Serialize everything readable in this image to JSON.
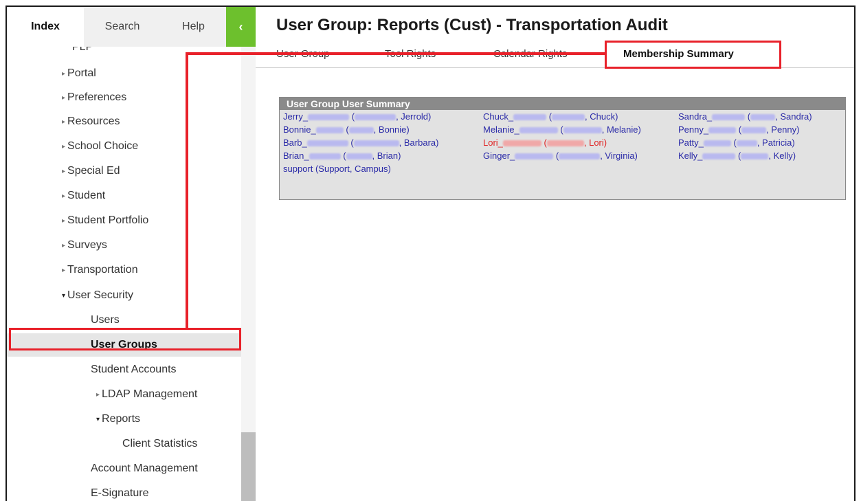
{
  "nav_tabs": [
    "Index",
    "Search",
    "Help"
  ],
  "collapse_glyph": "‹",
  "tree_partial": "PLP",
  "tree": [
    {
      "label": "Portal",
      "arrow": "▸"
    },
    {
      "label": "Preferences",
      "arrow": "▸"
    },
    {
      "label": "Resources",
      "arrow": "▸"
    },
    {
      "label": "School Choice",
      "arrow": "▸"
    },
    {
      "label": "Special Ed",
      "arrow": "▸"
    },
    {
      "label": "Student",
      "arrow": "▸"
    },
    {
      "label": "Student Portfolio",
      "arrow": "▸"
    },
    {
      "label": "Surveys",
      "arrow": "▸"
    },
    {
      "label": "Transportation",
      "arrow": "▸"
    },
    {
      "label": "User Security",
      "arrow": "▾"
    },
    {
      "label": "Users",
      "arrow": ""
    },
    {
      "label": "User Groups",
      "arrow": ""
    },
    {
      "label": "Student Accounts",
      "arrow": ""
    },
    {
      "label": "LDAP Management",
      "arrow": "▸"
    },
    {
      "label": "Reports",
      "arrow": "▾"
    },
    {
      "label": "Client Statistics",
      "arrow": ""
    },
    {
      "label": "Account Management",
      "arrow": ""
    },
    {
      "label": "E-Signature",
      "arrow": ""
    }
  ],
  "page_title": "User Group: Reports (Cust) - Transportation Audit",
  "subtabs": [
    "User Group",
    "Tool Rights",
    "Calendar Rights",
    "Membership Summary"
  ],
  "panel_title": "User Group User Summary",
  "members": [
    {
      "first": "Jerry_",
      "rest": ", Jerrold)"
    },
    {
      "first": "Chuck_",
      "rest": ", Chuck)"
    },
    {
      "first": "Sandra_",
      "rest": ", Sandra)"
    },
    {
      "first": "Bonnie_",
      "rest": ", Bonnie)"
    },
    {
      "first": "Melanie_",
      "rest": ", Melanie)"
    },
    {
      "first": "Penny_",
      "rest": ", Penny)"
    },
    {
      "first": "Barb_",
      "rest": ", Barbara)"
    },
    {
      "first": "Lori_",
      "rest": ", Lori)"
    },
    {
      "first": "Patty_",
      "rest": ", Patricia)"
    },
    {
      "first": "Brian_",
      "rest": ", Brian)"
    },
    {
      "first": "Ginger_",
      "rest": ", Virginia)"
    },
    {
      "first": "Kelly_",
      "rest": ", Kelly)"
    },
    {
      "first": "support (Support, Campus)",
      "rest": ""
    }
  ],
  "colors": {
    "accent_green": "#6dc02d",
    "highlight_red": "#e8212a",
    "link_blue": "#2a2aa8",
    "link_red": "#e02020"
  }
}
